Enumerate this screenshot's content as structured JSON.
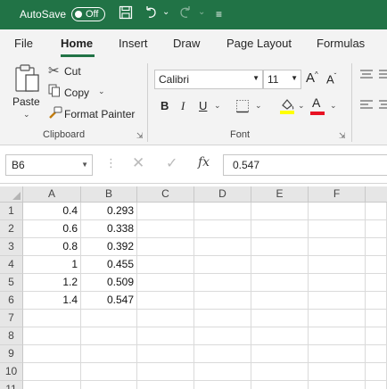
{
  "titlebar": {
    "autosave_label": "AutoSave",
    "autosave_state": "Off"
  },
  "ribbon_tabs": [
    "File",
    "Home",
    "Insert",
    "Draw",
    "Page Layout",
    "Formulas"
  ],
  "clipboard": {
    "paste": "Paste",
    "cut": "Cut",
    "copy": "Copy",
    "format_painter": "Format Painter",
    "group_label": "Clipboard"
  },
  "font": {
    "name": "Calibri",
    "size": "11",
    "grow": "A",
    "shrink": "A",
    "bold": "B",
    "italic": "I",
    "underline": "U",
    "color_letter": "A",
    "group_label": "Font",
    "fill_color": "#ffff00",
    "font_color": "#e81123"
  },
  "formula_bar": {
    "name_box": "B6",
    "fx": "fx",
    "value": "0.547"
  },
  "grid": {
    "columns": [
      "A",
      "B",
      "C",
      "D",
      "E",
      "F"
    ],
    "row_numbers": [
      "1",
      "2",
      "3",
      "4",
      "5",
      "6",
      "7",
      "8",
      "9",
      "10",
      "11"
    ],
    "rows": [
      [
        "0.4",
        "0.293"
      ],
      [
        "0.6",
        "0.338"
      ],
      [
        "0.8",
        "0.392"
      ],
      [
        "1",
        "0.455"
      ],
      [
        "1.2",
        "0.509"
      ],
      [
        "1.4",
        "0.547"
      ]
    ]
  },
  "colors": {
    "brand": "#217346",
    "ribbon_bg": "#f3f3f3"
  }
}
